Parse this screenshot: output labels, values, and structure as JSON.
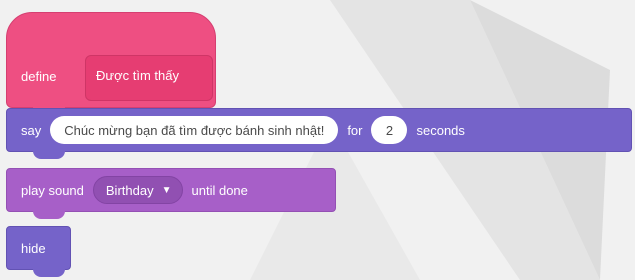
{
  "define_block": {
    "keyword": "define",
    "name": "Được tìm thấy",
    "color": "#ee4f82"
  },
  "say_block": {
    "keyword": "say",
    "message": "Chúc mừng bạn đã tìm được bánh sinh nhật!",
    "for_label": "for",
    "duration": "2",
    "seconds_label": "seconds",
    "color": "#7563c9"
  },
  "play_sound_block": {
    "keyword": "play sound",
    "sound": "Birthday",
    "caret_icon": "caret-down-icon",
    "suffix": "until done",
    "color": "#a75fc8"
  },
  "hide_block": {
    "keyword": "hide",
    "color": "#7563c9"
  }
}
